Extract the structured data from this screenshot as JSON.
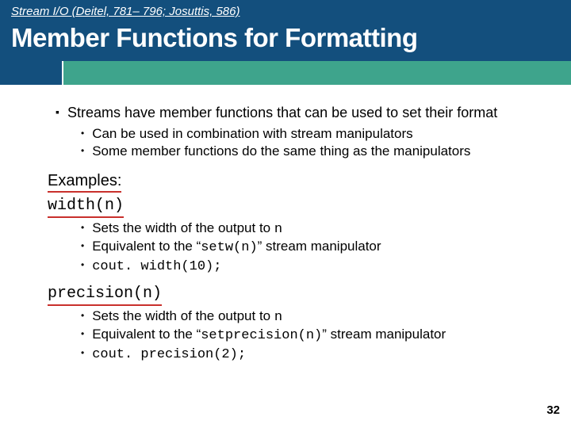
{
  "header": {
    "subheading": "Stream I/O (Deitel, 781– 796; Josuttis, 586)",
    "title": "Member Functions for Formatting"
  },
  "body": {
    "point1": "Streams have member functions that can be used to set their format",
    "point1_sub1": "Can be used in combination with stream manipulators",
    "point1_sub2": "Some member functions do the same thing as the manipulators",
    "examples_label": "Examples:",
    "width_head": "width(n)",
    "width_b1_a": "Sets the width of the output to ",
    "width_b1_b": "n",
    "width_b2_a": "Equivalent to the “",
    "width_b2_b": "setw(n)",
    "width_b2_c": "” stream manipulator",
    "width_b3": "cout. width(10);",
    "prec_head": "precision(n)",
    "prec_b1_a": "Sets the width of the output to ",
    "prec_b1_b": "n",
    "prec_b2_a": "Equivalent to the “",
    "prec_b2_b": "setprecision(n)",
    "prec_b2_c": "” stream manipulator",
    "prec_b3": "cout. precision(2);"
  },
  "pagenum": "32"
}
